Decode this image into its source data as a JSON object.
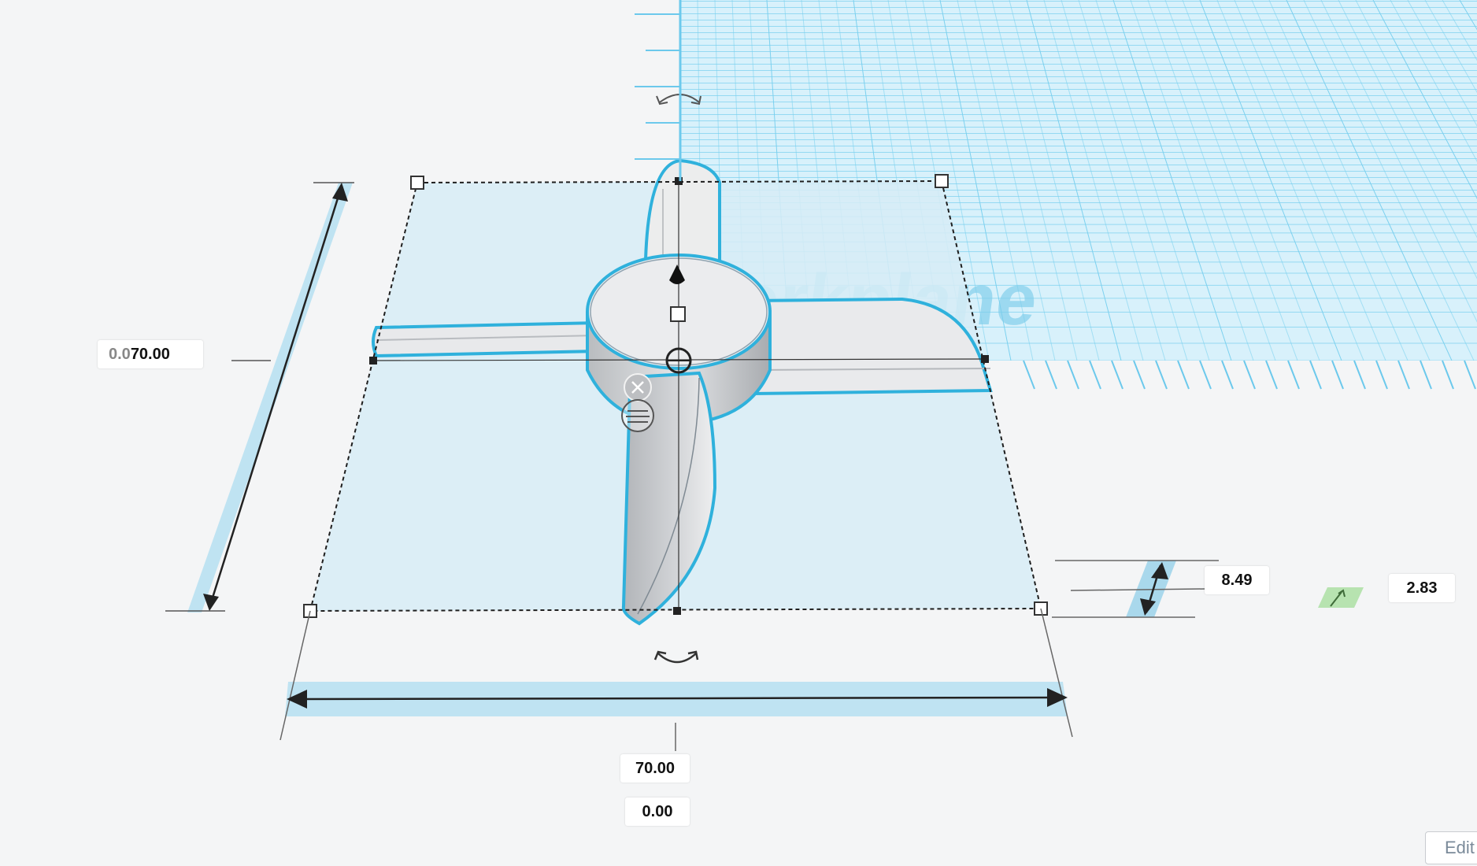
{
  "workplane": {
    "label": "Workplane",
    "grid_color": "#5ec8ec",
    "grid_bg": "#d8f1fb"
  },
  "selection": {
    "fill": "#d7ecf6",
    "outline_color": "#2fb1dc"
  },
  "dimensions": {
    "length_ghost": "0.0",
    "length": "70.00",
    "width": "70.00",
    "elevation": "0.00",
    "height": "8.49",
    "offset": "2.83"
  },
  "controls": {
    "edit_label": "Edit"
  }
}
